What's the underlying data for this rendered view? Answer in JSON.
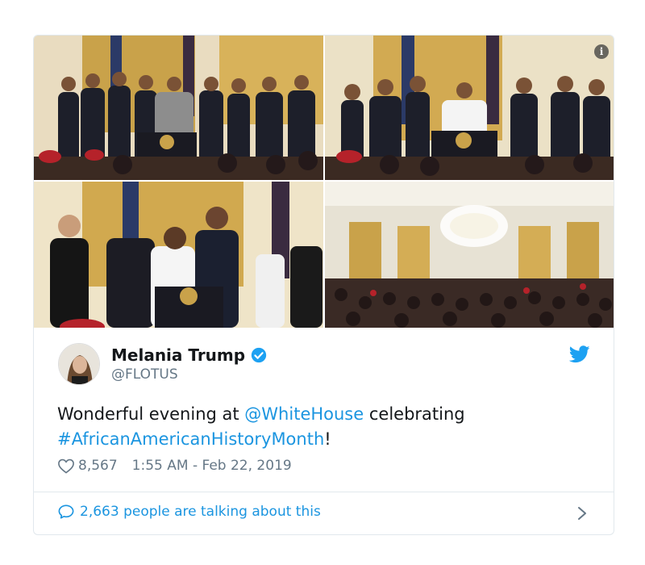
{
  "tweet": {
    "author_name": "Melania Trump",
    "handle": "@FLOTUS",
    "text_prefix": "Wonderful evening at ",
    "mention": "@WhiteHouse",
    "text_middle": " celebrating ",
    "hashtag": "#AfricanAmericanHistoryMonth",
    "text_suffix": "!",
    "likes": "8,567",
    "timestamp": "1:55 AM - Feb 22, 2019",
    "talking": "2,663 people are talking about this"
  },
  "media": {
    "info_label": "i",
    "photo_count": 4
  },
  "colors": {
    "link": "#1b95e0",
    "secondary_text": "#657786",
    "border": "#e1e8ed",
    "verified": "#1da1f2",
    "twitter_blue": "#1da1f2",
    "drape_gold": "#c9a24a"
  },
  "icons": {
    "verified": "verified-badge-icon",
    "bird": "twitter-bird-icon",
    "like": "heart-outline-icon",
    "reply": "speech-bubble-icon",
    "chevron": "chevron-right-icon",
    "info": "info-icon"
  }
}
